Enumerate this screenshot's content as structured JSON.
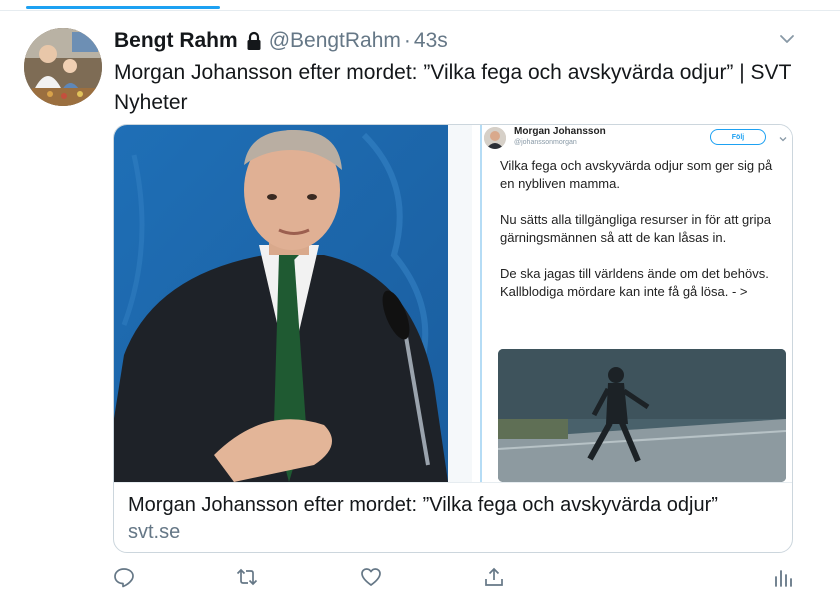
{
  "tweet": {
    "display_name": "Bengt Rahm",
    "handle": "@BengtRahm",
    "separator": "·",
    "time": "43s",
    "text": "Morgan Johansson efter mordet: ”Vilka fega och avskyvärda odjur” | SVT Nyheter"
  },
  "card": {
    "title": "Morgan Johansson efter mordet: ”Vilka fega och avskyvärda odjur”",
    "domain": "svt.se",
    "embedded_tweet": {
      "name": "Morgan Johansson",
      "handle": "@johanssonmorgan",
      "follow_label": "Följ",
      "paragraphs": [
        "Vilka fega och avskyvärda odjur som ger sig på en nybliven mamma.",
        "Nu sätts alla tillgängliga resurser in för att gripa gärningsmännen så att de kan låsas in.",
        "De ska jagas till världens ände om det behövs. Kallblodiga mördare kan inte få gå lösa. - >"
      ]
    }
  },
  "icons": {
    "lock": "lock-icon",
    "caret": "chevron-down-icon",
    "reply": "reply-icon",
    "retweet": "retweet-icon",
    "like": "heart-icon",
    "share": "share-icon",
    "analytics": "analytics-icon"
  },
  "colors": {
    "accent": "#1da1f2",
    "text_primary": "#14171a",
    "text_secondary": "#657786",
    "border": "#ccd6dd"
  }
}
